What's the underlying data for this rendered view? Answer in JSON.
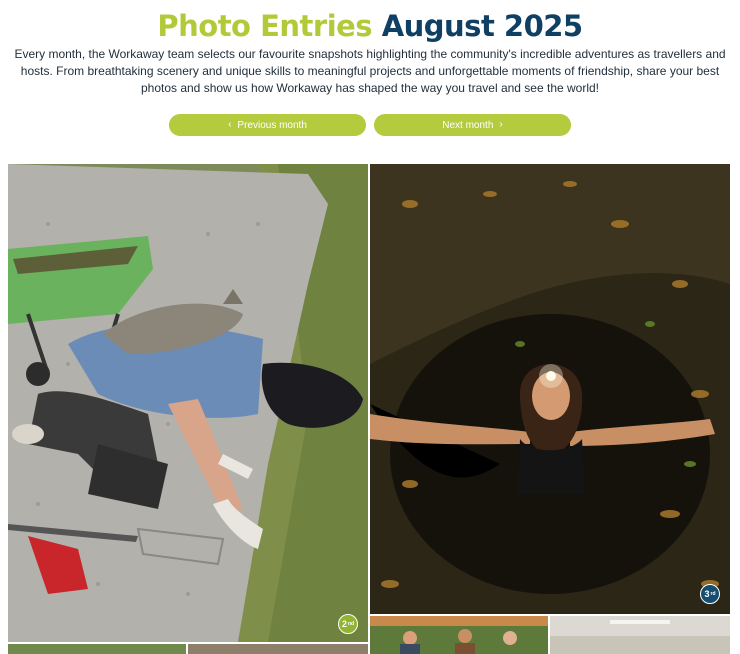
{
  "header": {
    "title_part1": "Photo Entries",
    "title_part2": "August 2025",
    "intro": "Every month, the Workaway team selects our favourite snapshots highlighting the community's incredible adventures as travellers and hosts. From breathtaking scenery and unique skills to meaningful projects and unforgettable moments of friendship, share your best photos and show us how Workaway has shaped the way you travel and see the world!"
  },
  "navigation": {
    "prev_label": "Previous month",
    "next_label": "Next month",
    "prev_icon": "chevron-left-icon",
    "next_icon": "chevron-right-icon"
  },
  "gallery": {
    "photos": [
      {
        "id": "photo-1",
        "description": "gardener-with-cat",
        "badge": "2"
      },
      {
        "id": "photo-2",
        "description": "cave-headlamp",
        "badge": "3"
      },
      {
        "id": "photo-3",
        "description": "partial-photo",
        "badge": ""
      },
      {
        "id": "photo-4",
        "description": "partial-photo",
        "badge": ""
      },
      {
        "id": "photo-5",
        "description": "group-outdoors",
        "badge": ""
      },
      {
        "id": "photo-6",
        "description": "indoor-room",
        "badge": ""
      }
    ],
    "badge_superscript": "nd",
    "badge_superscript_2": "rd"
  },
  "colors": {
    "lime": "#b2c93a",
    "navy": "#0f3f63",
    "button": "#b4cb3e",
    "badge_green": "#8fb531",
    "badge_blue": "#164e72"
  }
}
